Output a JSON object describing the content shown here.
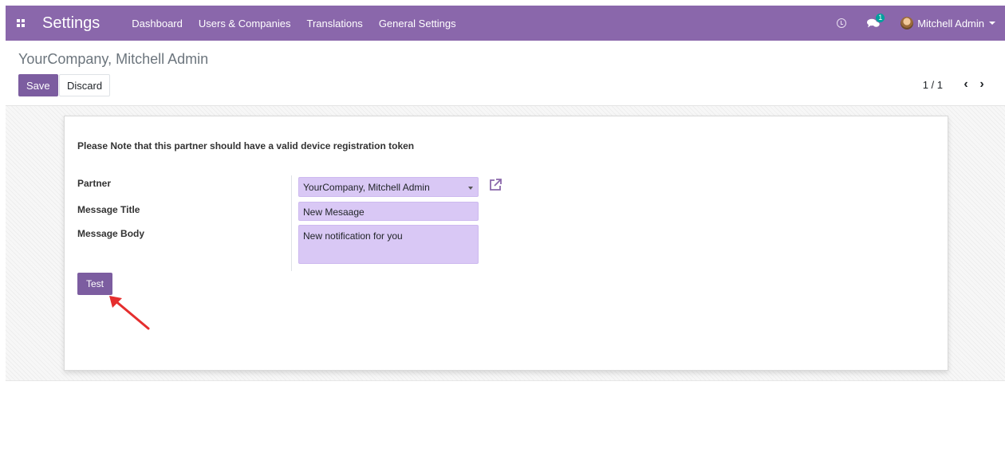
{
  "navbar": {
    "app_title": "Settings",
    "menu": [
      "Dashboard",
      "Users & Companies",
      "Translations",
      "General Settings"
    ],
    "messages_badge": "1",
    "user_name": "Mitchell Admin"
  },
  "control_panel": {
    "breadcrumb": "YourCompany, Mitchell Admin",
    "save_label": "Save",
    "discard_label": "Discard",
    "pager": "1 / 1"
  },
  "form": {
    "note": "Please Note that this partner should have a valid device registration token",
    "partner_label": "Partner",
    "partner_value": "YourCompany, Mitchell Admin",
    "title_label": "Message Title",
    "title_value": "New Mesaage",
    "body_label": "Message Body",
    "body_value": "New notification for you",
    "test_label": "Test"
  },
  "colors": {
    "brand": "#8a67ab",
    "primary_button": "#7c5da0",
    "field_bg": "#d9c8f5",
    "annotation_arrow": "#e52e2e"
  }
}
